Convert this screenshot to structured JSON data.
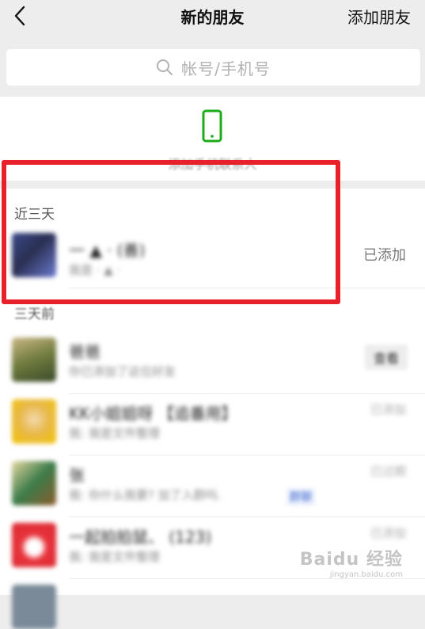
{
  "header": {
    "title": "新的朋友",
    "add_friends_label": "添加朋友"
  },
  "search": {
    "placeholder": "帐号/手机号"
  },
  "contacts": {
    "label": "添加手机联系人",
    "icon_color": "#1aad19"
  },
  "sections": {
    "recent_title": "近三天",
    "older_title": "三天前"
  },
  "recent_items": [
    {
      "name": "一 ▲ · (善)",
      "subtitle": "我是 · ▲ ·",
      "status": "已添加"
    }
  ],
  "older_items": [
    {
      "name": "爸爸",
      "subtitle": "你已添加了这位好友",
      "action": "查看"
    },
    {
      "name": "KK小姐姐呀 【追番用】",
      "subtitle": "我: 我是文件整理",
      "status": "已添加"
    },
    {
      "name": "张",
      "subtitle": "我: 你什么我要? 加了入群吗.",
      "status": "已过期",
      "tag": "群聊"
    },
    {
      "name": "一起拍拍鼠、 (123)",
      "subtitle": "我: 我是文件整理",
      "status": "已添加"
    }
  ],
  "overlay": {
    "highlight_color": "#e8202a"
  },
  "watermark": {
    "brand": "Baidu 经验",
    "url": "jingyan.baidu.com"
  }
}
